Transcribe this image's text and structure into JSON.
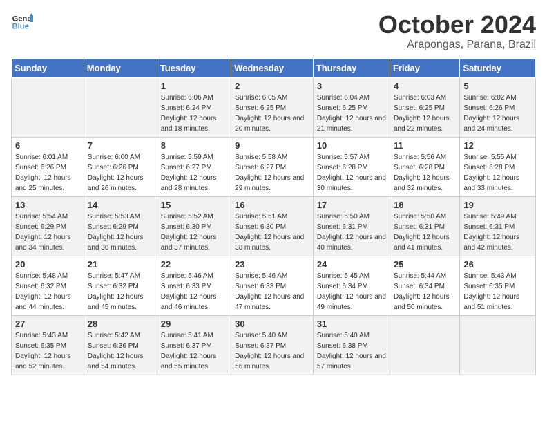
{
  "logo": {
    "line1": "General",
    "line2": "Blue"
  },
  "title": "October 2024",
  "subtitle": "Arapongas, Parana, Brazil",
  "weekdays": [
    "Sunday",
    "Monday",
    "Tuesday",
    "Wednesday",
    "Thursday",
    "Friday",
    "Saturday"
  ],
  "weeks": [
    [
      {
        "day": "",
        "sunrise": "",
        "sunset": "",
        "daylight": ""
      },
      {
        "day": "",
        "sunrise": "",
        "sunset": "",
        "daylight": ""
      },
      {
        "day": "1",
        "sunrise": "Sunrise: 6:06 AM",
        "sunset": "Sunset: 6:24 PM",
        "daylight": "Daylight: 12 hours and 18 minutes."
      },
      {
        "day": "2",
        "sunrise": "Sunrise: 6:05 AM",
        "sunset": "Sunset: 6:25 PM",
        "daylight": "Daylight: 12 hours and 20 minutes."
      },
      {
        "day": "3",
        "sunrise": "Sunrise: 6:04 AM",
        "sunset": "Sunset: 6:25 PM",
        "daylight": "Daylight: 12 hours and 21 minutes."
      },
      {
        "day": "4",
        "sunrise": "Sunrise: 6:03 AM",
        "sunset": "Sunset: 6:25 PM",
        "daylight": "Daylight: 12 hours and 22 minutes."
      },
      {
        "day": "5",
        "sunrise": "Sunrise: 6:02 AM",
        "sunset": "Sunset: 6:26 PM",
        "daylight": "Daylight: 12 hours and 24 minutes."
      }
    ],
    [
      {
        "day": "6",
        "sunrise": "Sunrise: 6:01 AM",
        "sunset": "Sunset: 6:26 PM",
        "daylight": "Daylight: 12 hours and 25 minutes."
      },
      {
        "day": "7",
        "sunrise": "Sunrise: 6:00 AM",
        "sunset": "Sunset: 6:26 PM",
        "daylight": "Daylight: 12 hours and 26 minutes."
      },
      {
        "day": "8",
        "sunrise": "Sunrise: 5:59 AM",
        "sunset": "Sunset: 6:27 PM",
        "daylight": "Daylight: 12 hours and 28 minutes."
      },
      {
        "day": "9",
        "sunrise": "Sunrise: 5:58 AM",
        "sunset": "Sunset: 6:27 PM",
        "daylight": "Daylight: 12 hours and 29 minutes."
      },
      {
        "day": "10",
        "sunrise": "Sunrise: 5:57 AM",
        "sunset": "Sunset: 6:28 PM",
        "daylight": "Daylight: 12 hours and 30 minutes."
      },
      {
        "day": "11",
        "sunrise": "Sunrise: 5:56 AM",
        "sunset": "Sunset: 6:28 PM",
        "daylight": "Daylight: 12 hours and 32 minutes."
      },
      {
        "day": "12",
        "sunrise": "Sunrise: 5:55 AM",
        "sunset": "Sunset: 6:28 PM",
        "daylight": "Daylight: 12 hours and 33 minutes."
      }
    ],
    [
      {
        "day": "13",
        "sunrise": "Sunrise: 5:54 AM",
        "sunset": "Sunset: 6:29 PM",
        "daylight": "Daylight: 12 hours and 34 minutes."
      },
      {
        "day": "14",
        "sunrise": "Sunrise: 5:53 AM",
        "sunset": "Sunset: 6:29 PM",
        "daylight": "Daylight: 12 hours and 36 minutes."
      },
      {
        "day": "15",
        "sunrise": "Sunrise: 5:52 AM",
        "sunset": "Sunset: 6:30 PM",
        "daylight": "Daylight: 12 hours and 37 minutes."
      },
      {
        "day": "16",
        "sunrise": "Sunrise: 5:51 AM",
        "sunset": "Sunset: 6:30 PM",
        "daylight": "Daylight: 12 hours and 38 minutes."
      },
      {
        "day": "17",
        "sunrise": "Sunrise: 5:50 AM",
        "sunset": "Sunset: 6:31 PM",
        "daylight": "Daylight: 12 hours and 40 minutes."
      },
      {
        "day": "18",
        "sunrise": "Sunrise: 5:50 AM",
        "sunset": "Sunset: 6:31 PM",
        "daylight": "Daylight: 12 hours and 41 minutes."
      },
      {
        "day": "19",
        "sunrise": "Sunrise: 5:49 AM",
        "sunset": "Sunset: 6:31 PM",
        "daylight": "Daylight: 12 hours and 42 minutes."
      }
    ],
    [
      {
        "day": "20",
        "sunrise": "Sunrise: 5:48 AM",
        "sunset": "Sunset: 6:32 PM",
        "daylight": "Daylight: 12 hours and 44 minutes."
      },
      {
        "day": "21",
        "sunrise": "Sunrise: 5:47 AM",
        "sunset": "Sunset: 6:32 PM",
        "daylight": "Daylight: 12 hours and 45 minutes."
      },
      {
        "day": "22",
        "sunrise": "Sunrise: 5:46 AM",
        "sunset": "Sunset: 6:33 PM",
        "daylight": "Daylight: 12 hours and 46 minutes."
      },
      {
        "day": "23",
        "sunrise": "Sunrise: 5:46 AM",
        "sunset": "Sunset: 6:33 PM",
        "daylight": "Daylight: 12 hours and 47 minutes."
      },
      {
        "day": "24",
        "sunrise": "Sunrise: 5:45 AM",
        "sunset": "Sunset: 6:34 PM",
        "daylight": "Daylight: 12 hours and 49 minutes."
      },
      {
        "day": "25",
        "sunrise": "Sunrise: 5:44 AM",
        "sunset": "Sunset: 6:34 PM",
        "daylight": "Daylight: 12 hours and 50 minutes."
      },
      {
        "day": "26",
        "sunrise": "Sunrise: 5:43 AM",
        "sunset": "Sunset: 6:35 PM",
        "daylight": "Daylight: 12 hours and 51 minutes."
      }
    ],
    [
      {
        "day": "27",
        "sunrise": "Sunrise: 5:43 AM",
        "sunset": "Sunset: 6:35 PM",
        "daylight": "Daylight: 12 hours and 52 minutes."
      },
      {
        "day": "28",
        "sunrise": "Sunrise: 5:42 AM",
        "sunset": "Sunset: 6:36 PM",
        "daylight": "Daylight: 12 hours and 54 minutes."
      },
      {
        "day": "29",
        "sunrise": "Sunrise: 5:41 AM",
        "sunset": "Sunset: 6:37 PM",
        "daylight": "Daylight: 12 hours and 55 minutes."
      },
      {
        "day": "30",
        "sunrise": "Sunrise: 5:40 AM",
        "sunset": "Sunset: 6:37 PM",
        "daylight": "Daylight: 12 hours and 56 minutes."
      },
      {
        "day": "31",
        "sunrise": "Sunrise: 5:40 AM",
        "sunset": "Sunset: 6:38 PM",
        "daylight": "Daylight: 12 hours and 57 minutes."
      },
      {
        "day": "",
        "sunrise": "",
        "sunset": "",
        "daylight": ""
      },
      {
        "day": "",
        "sunrise": "",
        "sunset": "",
        "daylight": ""
      }
    ]
  ]
}
